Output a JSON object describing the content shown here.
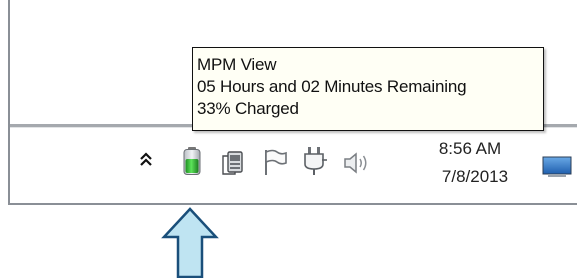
{
  "background_text": "(...)",
  "tooltip": {
    "title": "MPM View",
    "remaining": "05 Hours and 02 Minutes Remaining",
    "charge": "33% Charged"
  },
  "tray": {
    "icons": [
      "show-hidden-icons-chevron",
      "battery-green-icon",
      "network-adapter-icon",
      "action-center-flag-icon",
      "power-plug-icon",
      "speaker-volume-icon",
      "show-desktop-icon"
    ],
    "battery_level": 0.33,
    "battery_color": "#2db52d"
  },
  "clock": {
    "time": "8:56 AM",
    "date": "7/8/2013"
  },
  "arrow": {
    "color": "#bfe4f2",
    "outline": "#1a4f7a"
  }
}
